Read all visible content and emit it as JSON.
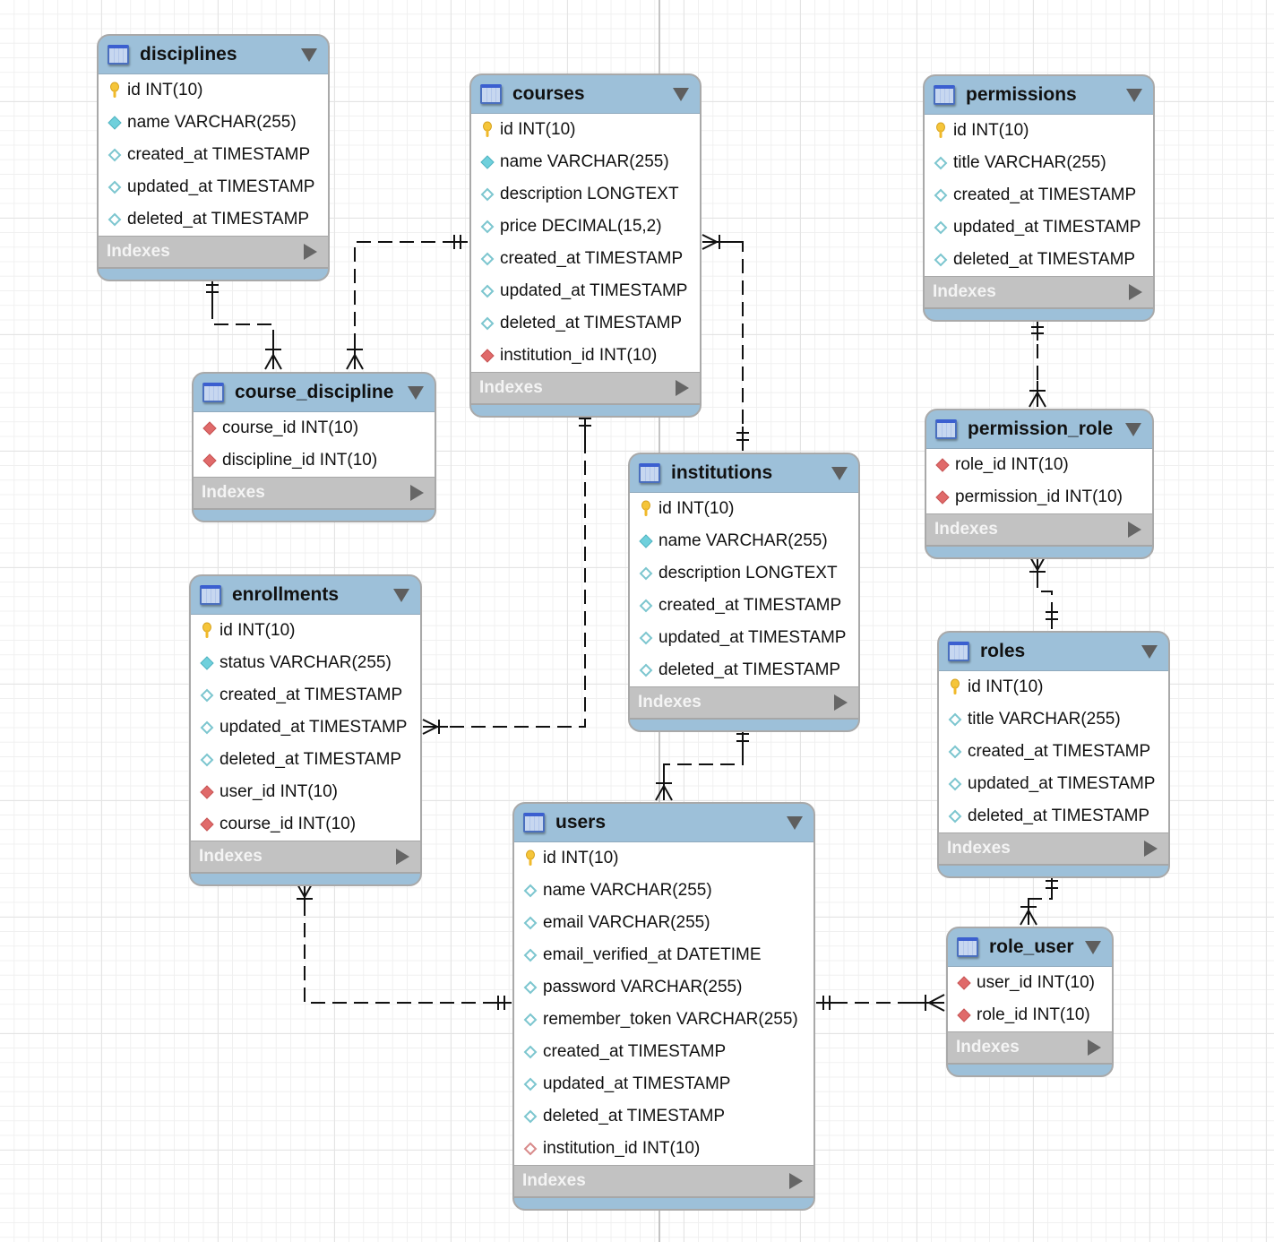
{
  "diagram": {
    "indexes_label": "Indexes",
    "tables": [
      {
        "id": "disciplines",
        "name": "disciplines",
        "columns": [
          {
            "name": "id INT(10)",
            "icon": "primary-key"
          },
          {
            "name": "name VARCHAR(255)",
            "icon": "filled-diamond"
          },
          {
            "name": "created_at TIMESTAMP",
            "icon": "hollow-diamond"
          },
          {
            "name": "updated_at TIMESTAMP",
            "icon": "hollow-diamond"
          },
          {
            "name": "deleted_at TIMESTAMP",
            "icon": "hollow-diamond"
          }
        ]
      },
      {
        "id": "courses",
        "name": "courses",
        "columns": [
          {
            "name": "id INT(10)",
            "icon": "primary-key"
          },
          {
            "name": "name VARCHAR(255)",
            "icon": "filled-diamond"
          },
          {
            "name": "description LONGTEXT",
            "icon": "hollow-diamond"
          },
          {
            "name": "price DECIMAL(15,2)",
            "icon": "hollow-diamond"
          },
          {
            "name": "created_at TIMESTAMP",
            "icon": "hollow-diamond"
          },
          {
            "name": "updated_at TIMESTAMP",
            "icon": "hollow-diamond"
          },
          {
            "name": "deleted_at TIMESTAMP",
            "icon": "hollow-diamond"
          },
          {
            "name": "institution_id INT(10)",
            "icon": "foreign-key"
          }
        ]
      },
      {
        "id": "permissions",
        "name": "permissions",
        "columns": [
          {
            "name": "id INT(10)",
            "icon": "primary-key"
          },
          {
            "name": "title VARCHAR(255)",
            "icon": "hollow-diamond"
          },
          {
            "name": "created_at TIMESTAMP",
            "icon": "hollow-diamond"
          },
          {
            "name": "updated_at TIMESTAMP",
            "icon": "hollow-diamond"
          },
          {
            "name": "deleted_at TIMESTAMP",
            "icon": "hollow-diamond"
          }
        ]
      },
      {
        "id": "course_discipline",
        "name": "course_discipline",
        "columns": [
          {
            "name": "course_id INT(10)",
            "icon": "foreign-key"
          },
          {
            "name": "discipline_id INT(10)",
            "icon": "foreign-key"
          }
        ]
      },
      {
        "id": "institutions",
        "name": "institutions",
        "columns": [
          {
            "name": "id INT(10)",
            "icon": "primary-key"
          },
          {
            "name": "name VARCHAR(255)",
            "icon": "filled-diamond"
          },
          {
            "name": "description LONGTEXT",
            "icon": "hollow-diamond"
          },
          {
            "name": "created_at TIMESTAMP",
            "icon": "hollow-diamond"
          },
          {
            "name": "updated_at TIMESTAMP",
            "icon": "hollow-diamond"
          },
          {
            "name": "deleted_at TIMESTAMP",
            "icon": "hollow-diamond"
          }
        ]
      },
      {
        "id": "permission_role",
        "name": "permission_role",
        "columns": [
          {
            "name": "role_id INT(10)",
            "icon": "foreign-key"
          },
          {
            "name": "permission_id INT(10)",
            "icon": "foreign-key"
          }
        ]
      },
      {
        "id": "enrollments",
        "name": "enrollments",
        "columns": [
          {
            "name": "id INT(10)",
            "icon": "primary-key"
          },
          {
            "name": "status VARCHAR(255)",
            "icon": "filled-diamond"
          },
          {
            "name": "created_at TIMESTAMP",
            "icon": "hollow-diamond"
          },
          {
            "name": "updated_at TIMESTAMP",
            "icon": "hollow-diamond"
          },
          {
            "name": "deleted_at TIMESTAMP",
            "icon": "hollow-diamond"
          },
          {
            "name": "user_id INT(10)",
            "icon": "foreign-key"
          },
          {
            "name": "course_id INT(10)",
            "icon": "foreign-key"
          }
        ]
      },
      {
        "id": "roles",
        "name": "roles",
        "columns": [
          {
            "name": "id INT(10)",
            "icon": "primary-key"
          },
          {
            "name": "title VARCHAR(255)",
            "icon": "hollow-diamond"
          },
          {
            "name": "created_at TIMESTAMP",
            "icon": "hollow-diamond"
          },
          {
            "name": "updated_at TIMESTAMP",
            "icon": "hollow-diamond"
          },
          {
            "name": "deleted_at TIMESTAMP",
            "icon": "hollow-diamond"
          }
        ]
      },
      {
        "id": "users",
        "name": "users",
        "columns": [
          {
            "name": "id INT(10)",
            "icon": "primary-key"
          },
          {
            "name": "name VARCHAR(255)",
            "icon": "hollow-diamond"
          },
          {
            "name": "email VARCHAR(255)",
            "icon": "hollow-diamond"
          },
          {
            "name": "email_verified_at DATETIME",
            "icon": "hollow-diamond"
          },
          {
            "name": "password VARCHAR(255)",
            "icon": "hollow-diamond"
          },
          {
            "name": "remember_token VARCHAR(255)",
            "icon": "hollow-diamond"
          },
          {
            "name": "created_at TIMESTAMP",
            "icon": "hollow-diamond"
          },
          {
            "name": "updated_at TIMESTAMP",
            "icon": "hollow-diamond"
          },
          {
            "name": "deleted_at TIMESTAMP",
            "icon": "hollow-diamond"
          },
          {
            "name": "institution_id INT(10)",
            "icon": "hollow-foreign-key"
          }
        ]
      },
      {
        "id": "role_user",
        "name": "role_user",
        "columns": [
          {
            "name": "user_id INT(10)",
            "icon": "foreign-key"
          },
          {
            "name": "role_id INT(10)",
            "icon": "foreign-key"
          }
        ]
      }
    ],
    "relationships": [
      {
        "from": "disciplines",
        "to": "course_discipline",
        "type": "one-to-many",
        "identifying": false
      },
      {
        "from": "courses",
        "to": "course_discipline",
        "type": "one-to-many",
        "identifying": false
      },
      {
        "from": "institutions",
        "to": "courses",
        "type": "one-to-many",
        "identifying": false
      },
      {
        "from": "courses",
        "to": "enrollments",
        "type": "one-to-many",
        "identifying": false
      },
      {
        "from": "institutions",
        "to": "users",
        "type": "one-to-many",
        "identifying": false
      },
      {
        "from": "users",
        "to": "enrollments",
        "type": "one-to-many",
        "identifying": false
      },
      {
        "from": "users",
        "to": "role_user",
        "type": "one-to-many",
        "identifying": false
      },
      {
        "from": "roles",
        "to": "role_user",
        "type": "one-to-many",
        "identifying": false
      },
      {
        "from": "permissions",
        "to": "permission_role",
        "type": "one-to-many",
        "identifying": false
      },
      {
        "from": "roles",
        "to": "permission_role",
        "type": "one-to-many",
        "identifying": false
      }
    ],
    "colors": {
      "header": "#9dc0d9",
      "indexes_bar": "#c2c2c2",
      "primary_key": "#f2c12e",
      "filled_diamond": "#6fd0dc",
      "foreign_key": "#e06a6a"
    }
  }
}
